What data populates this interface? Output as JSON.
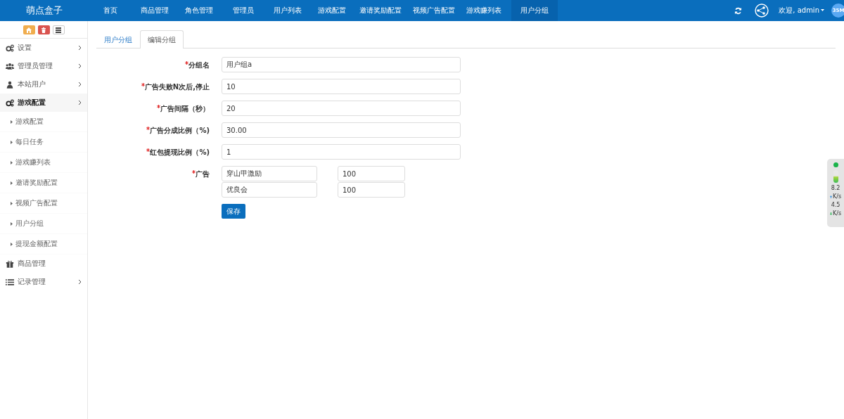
{
  "brand": "萌点盒子",
  "nav": [
    {
      "label": "首页",
      "selected": false
    },
    {
      "label": "商品管理",
      "selected": false
    },
    {
      "label": "角色管理",
      "selected": false
    },
    {
      "label": "管理员",
      "selected": false
    },
    {
      "label": "用户列表",
      "selected": false
    },
    {
      "label": "游戏配置",
      "selected": false
    },
    {
      "label": "邀请奖励配置",
      "selected": false
    },
    {
      "label": "视频广告配置",
      "selected": false
    },
    {
      "label": "游戏赚列表",
      "selected": false
    },
    {
      "label": "用户分组",
      "selected": true
    }
  ],
  "user": {
    "greeting": "欢迎, admin",
    "avatar": "35M"
  },
  "sidebar": [
    {
      "label": "设置",
      "expanded": false
    },
    {
      "label": "管理员管理",
      "expanded": false
    },
    {
      "label": "本站用户",
      "expanded": false
    },
    {
      "label": "游戏配置",
      "expanded": true,
      "children": [
        {
          "label": "游戏配置"
        },
        {
          "label": "每日任务"
        },
        {
          "label": "游戏赚列表"
        },
        {
          "label": "邀请奖励配置"
        },
        {
          "label": "视频广告配置"
        },
        {
          "label": "用户分组"
        },
        {
          "label": "提现金额配置"
        }
      ]
    },
    {
      "label": "商品管理"
    },
    {
      "label": "记录管理",
      "expanded": false
    }
  ],
  "tabs": [
    {
      "label": "用户分组",
      "selected": false
    },
    {
      "label": "编辑分组",
      "selected": true
    }
  ],
  "form": [
    {
      "kind": "text",
      "label": "分组名",
      "required": true,
      "value": "用户组a"
    },
    {
      "kind": "text",
      "label": "广告失败N次后,停止",
      "required": true,
      "value": "10"
    },
    {
      "kind": "text",
      "label": "广告间隔（秒）",
      "required": true,
      "value": "20"
    },
    {
      "kind": "text",
      "label": "广告分成比例（%)",
      "required": true,
      "value": "30.00"
    },
    {
      "kind": "text",
      "label": "红包提现比例（%)",
      "required": true,
      "value": "1"
    },
    {
      "kind": "pairs",
      "label": "广告",
      "required": true,
      "pairs": [
        {
          "name": "穿山甲激励",
          "value": "100"
        },
        {
          "name": "优良会",
          "value": "100"
        }
      ]
    }
  ],
  "save_button": "保存",
  "net_monitor": {
    "upload": "8.2",
    "upload_unit": "K/s",
    "download": "4.5",
    "download_unit": "K/s"
  }
}
